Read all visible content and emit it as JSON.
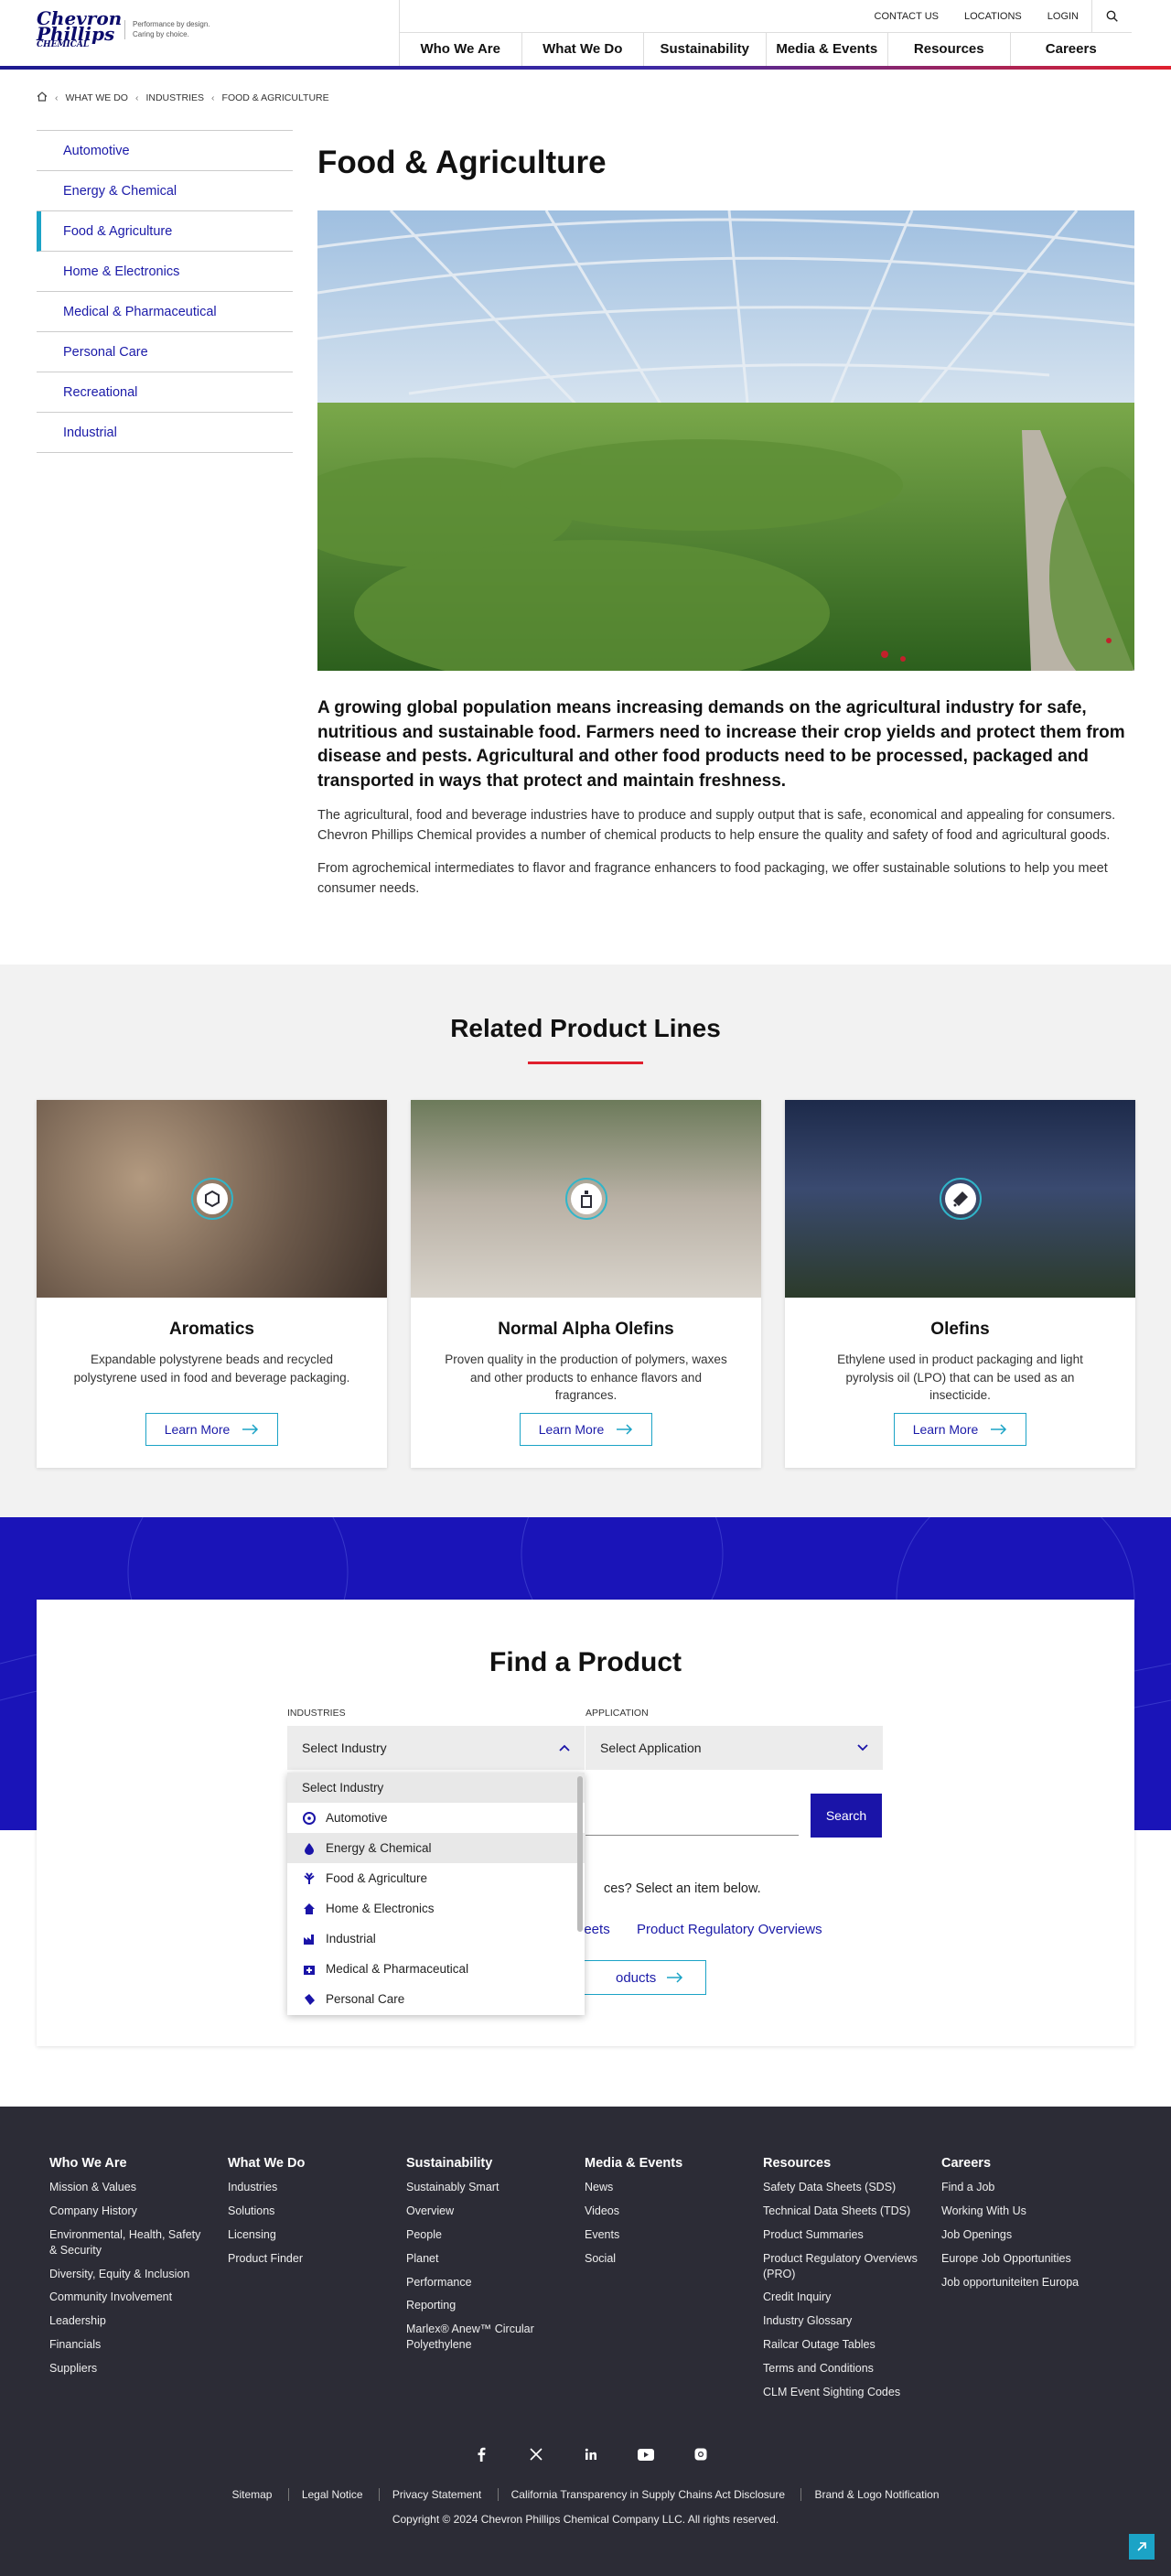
{
  "header": {
    "logo_line1": "Chevron",
    "logo_line2": "Phillips",
    "logo_line3": "CHEMICAL",
    "tagline_1": "Performance by design.",
    "tagline_2": "Caring by choice.",
    "util_links": [
      "CONTACT US",
      "LOCATIONS",
      "LOGIN"
    ],
    "nav": [
      "Who We Are",
      "What We Do",
      "Sustainability",
      "Media & Events",
      "Resources",
      "Careers"
    ]
  },
  "breadcrumb": [
    "WHAT WE DO",
    "INDUSTRIES",
    "FOOD & AGRICULTURE"
  ],
  "sidenav": [
    "Automotive",
    "Energy & Chemical",
    "Food & Agriculture",
    "Home & Electronics",
    "Medical & Pharmaceutical",
    "Personal Care",
    "Recreational",
    "Industrial"
  ],
  "sidenav_active": "Food & Agriculture",
  "main": {
    "title": "Food & Agriculture",
    "lead": "A growing global population means increasing demands on the agricultural industry for safe, nutritious and sustainable food. Farmers need to increase their crop yields and protect them from disease and pests. Agricultural and other food products need to be processed, packaged and transported in ways that protect and maintain freshness.",
    "p1": "The agricultural, food and beverage industries have to produce and supply output that is safe, economical and appealing for consumers. Chevron Phillips Chemical provides a number of chemical products to help ensure the quality and safety of food and agricultural goods.",
    "p2": "From agrochemical intermediates to flavor and fragrance enhancers to food packaging, we offer sustainable solutions to help you meet consumer needs."
  },
  "related": {
    "title": "Related Product Lines",
    "cards": [
      {
        "title": "Aromatics",
        "text": "Expandable polystyrene beads and recycled polystyrene used in food and beverage packaging.",
        "button": "Learn More"
      },
      {
        "title": "Normal Alpha Olefins",
        "text": "Proven quality in the production of polymers, waxes and other products to enhance flavors and fragrances.",
        "button": "Learn More"
      },
      {
        "title": "Olefins",
        "text": "Ethylene used in product packaging and light pyrolysis oil (LPO) that can be used as an insecticide.",
        "button": "Learn More"
      }
    ]
  },
  "find": {
    "title": "Find a Product",
    "industries_label": "INDUSTRIES",
    "application_label": "APPLICATION",
    "industry_value": "Select Industry",
    "application_value": "Select Application",
    "search_button": "Search",
    "prompt": "ces? Select an item below.",
    "link1": "heets",
    "link2": "Product Regulatory Overviews",
    "products_button": "oducts",
    "dropdown": [
      "Select Industry",
      "Automotive",
      "Energy & Chemical",
      "Food & Agriculture",
      "Home & Electronics",
      "Industrial",
      "Medical & Pharmaceutical",
      "Personal Care"
    ]
  },
  "footer": {
    "columns": [
      {
        "title": "Who We Are",
        "links": [
          "Mission & Values",
          "Company History",
          "Environmental, Health, Safety & Security",
          "Diversity, Equity & Inclusion",
          "Community Involvement",
          "Leadership",
          "Financials",
          "Suppliers"
        ]
      },
      {
        "title": "What We Do",
        "links": [
          "Industries",
          "Solutions",
          "Licensing",
          "Product Finder"
        ]
      },
      {
        "title": "Sustainability",
        "links": [
          "Sustainably Smart",
          "Overview",
          "People",
          "Planet",
          "Performance",
          "Reporting",
          "Marlex® Anew™ Circular Polyethylene"
        ]
      },
      {
        "title": "Media & Events",
        "links": [
          "News",
          "Videos",
          "Events",
          "Social"
        ]
      },
      {
        "title": "Resources",
        "links": [
          "Safety Data Sheets (SDS)",
          "Technical Data Sheets (TDS)",
          "Product Summaries",
          "Product Regulatory Overviews (PRO)",
          "Credit Inquiry",
          "Industry Glossary",
          "Railcar Outage Tables",
          "Terms and Conditions",
          "CLM Event Sighting Codes"
        ]
      },
      {
        "title": "Careers",
        "links": [
          "Find a Job",
          "Working With Us",
          "Job Openings",
          "Europe Job Opportunities",
          "Job opportuniteiten Europa"
        ]
      }
    ],
    "legal": [
      "Sitemap",
      "Legal Notice",
      "Privacy Statement",
      "California Transparency in Supply Chains Act Disclosure",
      "Brand & Logo Notification"
    ],
    "copyright": "Copyright © 2024 Chevron Phillips Chemical Company LLC. All rights reserved."
  }
}
